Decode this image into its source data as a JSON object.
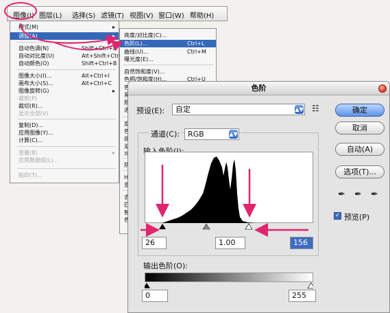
{
  "background_text": "",
  "menubar": [
    "图像(I)",
    "图层(L)",
    "选择(S)",
    "滤镜(T)",
    "视图(V)",
    "窗口(W)",
    "帮助(H)"
  ],
  "image_menu": [
    {
      "label": "模式(M)",
      "shortcut": "",
      "arrow": "▸",
      "state": ""
    },
    {
      "label": "调整(A)",
      "shortcut": "",
      "arrow": "▸",
      "state": "hl"
    },
    {
      "label": "自动色调(N)",
      "shortcut": "Shift+Ctrl+L",
      "arrow": "",
      "state": ""
    },
    {
      "label": "自动对比度(U)",
      "shortcut": "Alt+Shift+Ctrl+L",
      "arrow": "",
      "state": ""
    },
    {
      "label": "自动颜色(O)",
      "shortcut": "Shift+Ctrl+B",
      "arrow": "",
      "state": ""
    },
    {
      "label": "图像大小(I)...",
      "shortcut": "Alt+Ctrl+I",
      "arrow": "",
      "state": ""
    },
    {
      "label": "画布大小(S)...",
      "shortcut": "Alt+Ctrl+C",
      "arrow": "",
      "state": ""
    },
    {
      "label": "图像旋转(G)",
      "shortcut": "",
      "arrow": "▸",
      "state": ""
    },
    {
      "label": "裁剪(P)",
      "shortcut": "",
      "arrow": "",
      "state": "dis"
    },
    {
      "label": "裁切(R)...",
      "shortcut": "",
      "arrow": "",
      "state": ""
    },
    {
      "label": "显示全部(V)",
      "shortcut": "",
      "arrow": "",
      "state": "dis"
    },
    {
      "label": "复制(D)...",
      "shortcut": "",
      "arrow": "",
      "state": ""
    },
    {
      "label": "应用图像(Y)...",
      "shortcut": "",
      "arrow": "",
      "state": ""
    },
    {
      "label": "计算(C)...",
      "shortcut": "",
      "arrow": "",
      "state": ""
    },
    {
      "label": "变量(B)",
      "shortcut": "",
      "arrow": "▸",
      "state": "dis"
    },
    {
      "label": "应用数据组(L)...",
      "shortcut": "",
      "arrow": "",
      "state": "dis"
    },
    {
      "label": "陷印(T)...",
      "shortcut": "",
      "arrow": "",
      "state": "dis"
    }
  ],
  "adjust_menu": [
    {
      "label": "亮度/对比度(C)...",
      "shortcut": "",
      "state": ""
    },
    {
      "label": "色阶(L)...",
      "shortcut": "Ctrl+L",
      "state": "hl"
    },
    {
      "label": "曲线(U)...",
      "shortcut": "Ctrl+M",
      "state": ""
    },
    {
      "label": "曝光度(E)...",
      "shortcut": "",
      "state": ""
    },
    {
      "label": "自然饱和度(V)...",
      "shortcut": "",
      "state": ""
    },
    {
      "label": "色相/饱和度(H)...",
      "shortcut": "Ctrl+U",
      "state": ""
    },
    {
      "label": "色",
      "shortcut": "",
      "state": ""
    },
    {
      "label": "黑",
      "shortcut": "",
      "state": ""
    },
    {
      "label": "照",
      "shortcut": "",
      "state": ""
    },
    {
      "label": "通",
      "shortcut": "",
      "state": ""
    },
    {
      "label": "反",
      "shortcut": "",
      "state": ""
    },
    {
      "label": "色",
      "shortcut": "",
      "state": ""
    },
    {
      "label": "阈",
      "shortcut": "",
      "state": ""
    },
    {
      "label": "渐",
      "shortcut": "",
      "state": ""
    },
    {
      "label": "可",
      "shortcut": "",
      "state": ""
    },
    {
      "label": "阴",
      "shortcut": "",
      "state": ""
    },
    {
      "label": "HI",
      "shortcut": "",
      "state": ""
    },
    {
      "label": "变",
      "shortcut": "",
      "state": ""
    },
    {
      "label": "去",
      "shortcut": "",
      "state": ""
    },
    {
      "label": "匹",
      "shortcut": "",
      "state": ""
    },
    {
      "label": "替",
      "shortcut": "",
      "state": ""
    },
    {
      "label": "色",
      "shortcut": "",
      "state": ""
    }
  ],
  "dialog": {
    "title": "色阶",
    "preset_label": "预设(E):",
    "preset_value": "自定",
    "channel_label": "通道(C):",
    "channel_value": "RGB",
    "input_label": "输入色阶(I):",
    "input_black": "26",
    "input_gamma": "1.00",
    "input_white": "156",
    "output_label": "输出色阶(O):",
    "output_black": "0",
    "output_white": "255",
    "buttons": [
      "确定",
      "取消",
      "自动(A)",
      "选项(T)..."
    ],
    "preview_label": "预览(P)",
    "preview_checked": true
  },
  "colors": {
    "highlight": "#3568b8",
    "annotation": "#e0256f"
  },
  "icons": [
    "dropdown-arrow-icon",
    "preset-menu-icon",
    "eyedropper-black-icon",
    "eyedropper-gray-icon",
    "eyedropper-white-icon",
    "close-icon",
    "checkmark-icon"
  ]
}
